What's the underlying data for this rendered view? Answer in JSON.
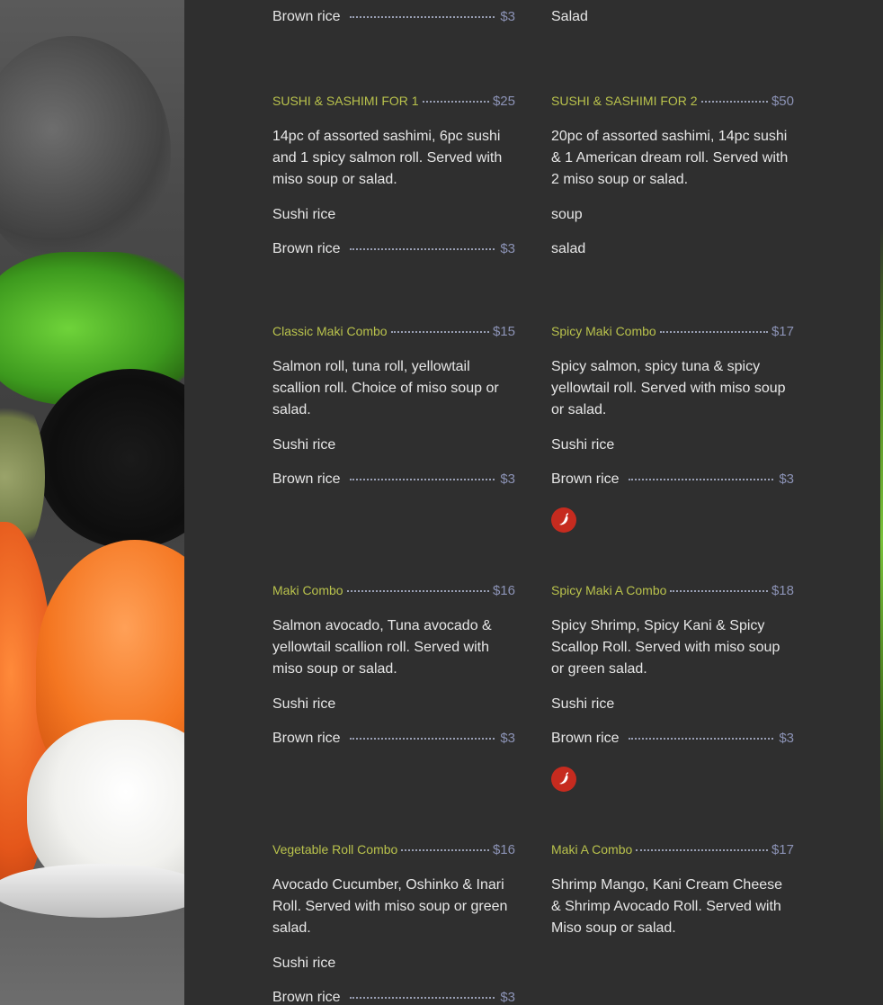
{
  "chili_icon": "chili-pepper-icon",
  "colors": {
    "title": "#b9c24c",
    "price": "#8c93b6",
    "text": "#e6e6e6",
    "background": "#2f2f2f",
    "chili_badge": "#c62b1f"
  },
  "top": {
    "left": {
      "option": "Brown rice",
      "price": "$3"
    },
    "right": {
      "option": "Salad"
    }
  },
  "menu": [
    {
      "title": "SUSHI & SASHIMI FOR 1",
      "price": "$25",
      "desc": "14pc of assorted sashimi, 6pc sushi and 1 spicy salmon roll. Served with miso soup or salad.",
      "opt1": "Sushi rice",
      "opt2": "Brown rice",
      "opt2_price": "$3"
    },
    {
      "title": "SUSHI & SASHIMI FOR 2",
      "price": "$50",
      "desc": "20pc of assorted sashimi, 14pc sushi & 1 American dream roll. Served with 2 miso soup or salad.",
      "opt1": "soup",
      "opt2": "salad"
    },
    {
      "title": "Classic Maki Combo",
      "price": "$15",
      "desc": "Salmon roll, tuna roll, yellowtail scallion roll. Choice of miso soup or salad.",
      "opt1": "Sushi rice",
      "opt2": "Brown rice",
      "opt2_price": "$3"
    },
    {
      "title": "Spicy Maki Combo",
      "price": "$17",
      "desc": "Spicy salmon, spicy tuna & spicy yellowtail roll. Served with miso soup or salad.",
      "opt1": "Sushi rice",
      "opt2": "Brown rice",
      "opt2_price": "$3"
    },
    {
      "title": "Maki Combo",
      "price": "$16",
      "desc": "Salmon avocado, Tuna avocado & yellowtail scallion roll. Served with miso soup or salad.",
      "opt1": "Sushi rice",
      "opt2": "Brown rice",
      "opt2_price": "$3"
    },
    {
      "title": "Spicy Maki A Combo",
      "price": "$18",
      "desc": "Spicy Shrimp, Spicy Kani & Spicy Scallop Roll. Served with miso soup or green salad.",
      "opt1": "Sushi rice",
      "opt2": "Brown rice",
      "opt2_price": "$3"
    },
    {
      "title": "Vegetable Roll Combo",
      "price": "$16",
      "desc": "Avocado Cucumber, Oshinko & Inari Roll. Served with miso soup or green salad.",
      "opt1": "Sushi rice",
      "opt2": "Brown rice",
      "opt2_price": "$3"
    },
    {
      "title": "Maki A Combo",
      "price": "$17",
      "desc": "Shrimp Mango, Kani Cream Cheese & Shrimp Avocado Roll. Served with Miso soup or salad."
    }
  ]
}
